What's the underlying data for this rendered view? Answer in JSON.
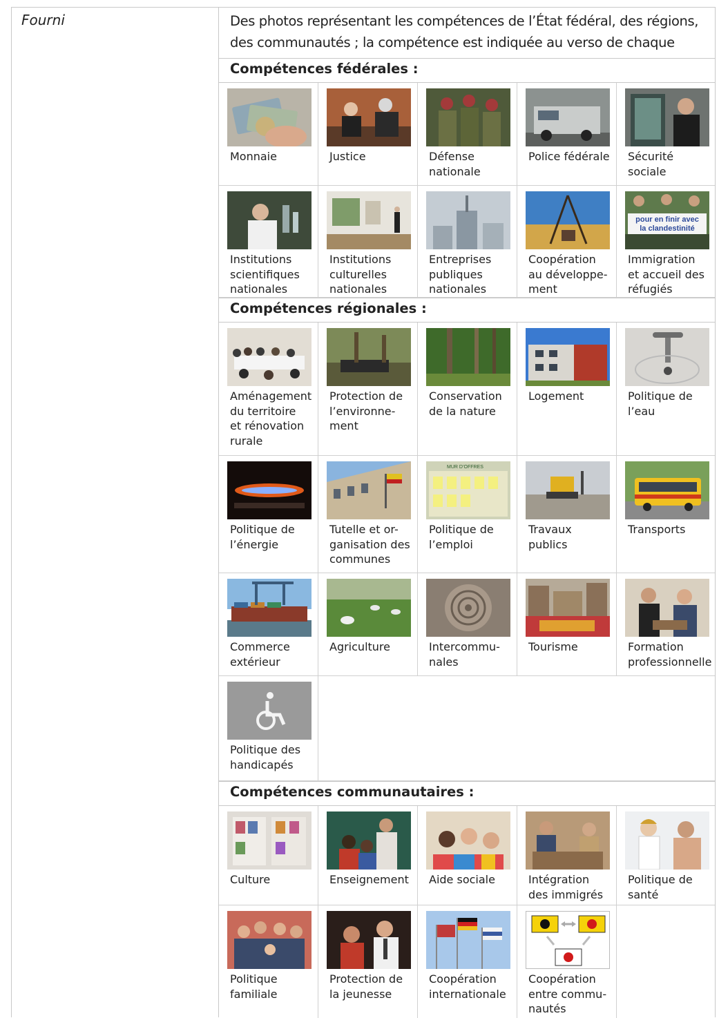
{
  "provided_label": "Fourni",
  "intro": "Des photos représentant les compétences de l’État fédéral, des régions, des communautés ; la compétence est indiquée au verso de chaque photo.",
  "sections": {
    "federal": {
      "title": "Compétences fédérales :",
      "row1": [
        "Monnaie",
        "Justice",
        "Défense\nnationale",
        "Police fédérale",
        "Sécurité\nsociale"
      ],
      "row2": [
        "Institutions\nscientifiques\nnationales",
        "Institutions\nculturelles\nnationales",
        "Entreprises\npubliques\nnationales",
        "Coopération\nau développe-\nment",
        "Immigration\net accueil des\nréfugiés"
      ]
    },
    "regional": {
      "title": "Compétences régionales :",
      "row1": [
        "Aménagement\ndu territoire\net rénovation\nrurale",
        "Protection de\nl’environne-\nment",
        "Conservation\nde la nature",
        "Logement",
        "Politique de\nl’eau"
      ],
      "row2": [
        "Politique de\nl’énergie",
        "Tutelle et or-\nganisation des\ncommunes",
        "Politique de\nl’emploi",
        "Travaux\npublics",
        "Transports"
      ],
      "row3": [
        "Commerce\nextérieur",
        "Agriculture",
        "Intercommu-\nnales",
        "Tourisme",
        "Formation\nprofessionnelle"
      ],
      "row4": [
        "Politique des\nhandicapés"
      ]
    },
    "community": {
      "title": "Compétences communautaires :",
      "row1": [
        "Culture",
        "Enseignement",
        "Aide sociale",
        "Intégration\ndes immigrés",
        "Politique de\nsanté"
      ],
      "row2": [
        "Politique\nfamiliale",
        "Protection de\nla jeunesse",
        "Coopération\ninternationale",
        "Coopération\nentre commu-\nnautés"
      ]
    }
  },
  "photo_text": {
    "immigration_banner": "pour en finir avec\nla clandestinité",
    "employment_sign": "MUR D’OFFRES"
  },
  "colors": {
    "border": "#c8c8c8",
    "text": "#222222",
    "flanders_yellow": "#f5d20a",
    "wallonia_yellow": "#f5d20a",
    "rooster_red": "#d11a1a"
  }
}
